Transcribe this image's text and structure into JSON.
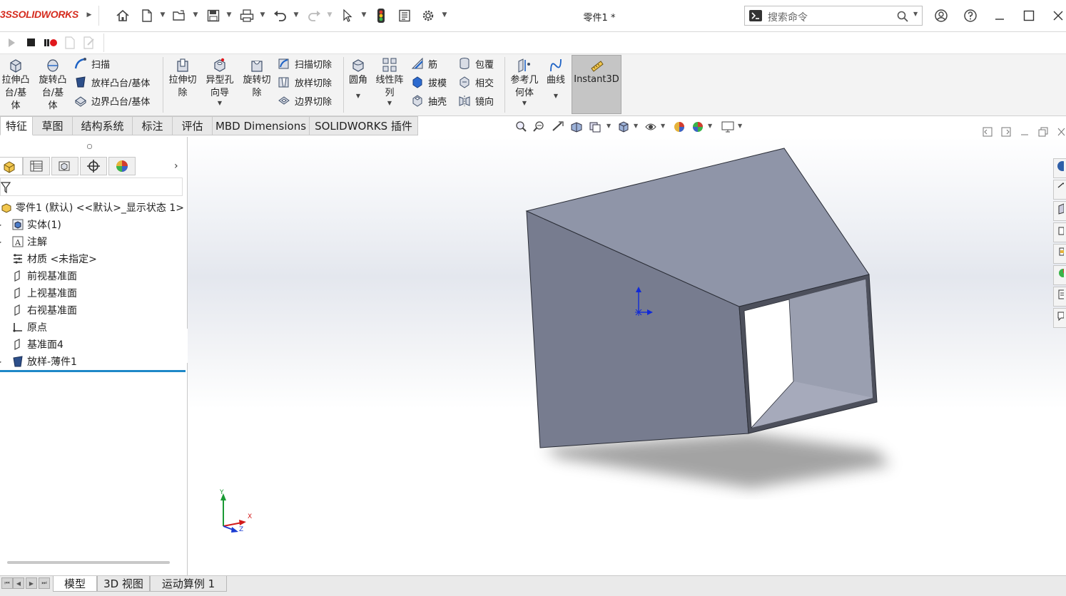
{
  "app": {
    "logo_brand": "SOLIDWORKS",
    "logo_prefix": "3S",
    "doc_title": "零件1 *",
    "search_placeholder": "搜索命令"
  },
  "commands": {
    "extrude_boss": "拉伸凸\n台/基\n体",
    "revolve_boss": "旋转凸\n台/基\n体",
    "sweep": "扫描",
    "loft_boss": "放样凸台/基体",
    "boundary_boss": "边界凸台/基体",
    "extrude_cut": "拉伸切\n除",
    "hole_wizard": "异型孔\n向导",
    "revolve_cut": "旋转切\n除",
    "swept_cut": "扫描切除",
    "lofted_cut": "放样切除",
    "boundary_cut": "边界切除",
    "fillet": "圆角",
    "linear_pattern": "线性阵\n列",
    "rib": "筋",
    "draft": "拔模",
    "shell": "抽壳",
    "wrap": "包覆",
    "intersect": "相交",
    "mirror": "镜向",
    "ref_geometry": "参考几\n何体",
    "curves": "曲线",
    "instant3d": "Instant3D"
  },
  "tabs": [
    "特征",
    "草图",
    "结构系统",
    "标注",
    "评估",
    "MBD Dimensions",
    "SOLIDWORKS 插件"
  ],
  "tree": {
    "root": "零件1 (默认) <<默认>_显示状态 1>",
    "items": [
      {
        "label": "实体(1)",
        "icon": "solid-bodies-icon",
        "expandable": true
      },
      {
        "label": "注解",
        "icon": "annotations-icon",
        "expandable": true
      },
      {
        "label": "材质 <未指定>",
        "icon": "material-icon",
        "expandable": false
      },
      {
        "label": "前视基准面",
        "icon": "plane-icon",
        "expandable": false
      },
      {
        "label": "上视基准面",
        "icon": "plane-icon",
        "expandable": false
      },
      {
        "label": "右视基准面",
        "icon": "plane-icon",
        "expandable": false
      },
      {
        "label": "原点",
        "icon": "origin-icon",
        "expandable": false
      },
      {
        "label": "基准面4",
        "icon": "plane-icon",
        "expandable": false
      },
      {
        "label": "放样-薄件1",
        "icon": "loft-feature-icon",
        "expandable": true
      }
    ]
  },
  "triad": {
    "x": "X",
    "y": "Y",
    "z": "Z"
  },
  "bottom_tabs": [
    "模型",
    "3D 视图",
    "运动算例 1"
  ],
  "colors": {
    "model_face_top": "#9096a8",
    "model_face_side": "#7c8194",
    "shadow": "#8a8a8a",
    "logo_red": "#d52b1e",
    "active_tree_line": "#1e88c8"
  }
}
